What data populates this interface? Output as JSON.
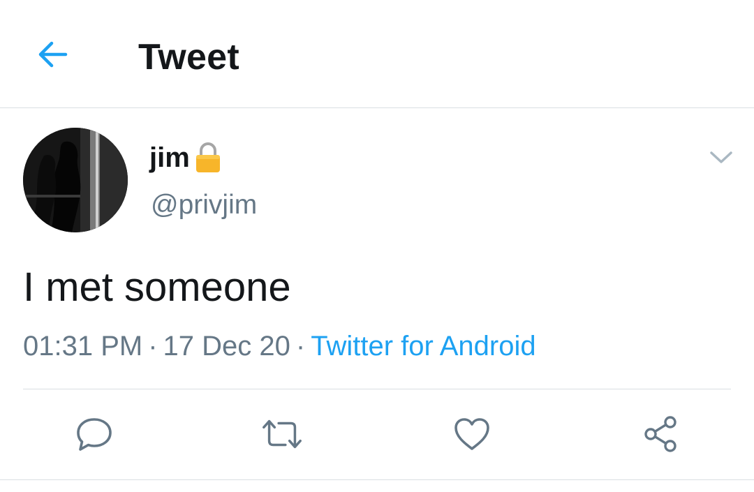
{
  "header": {
    "title": "Tweet",
    "back_icon": "arrow-left-icon"
  },
  "author": {
    "display_name": "jim",
    "protected_icon": "lock-icon",
    "handle": "@privjim"
  },
  "tweet": {
    "text": "I met someone",
    "time": "01:31 PM",
    "separator": "·",
    "date": "17 Dec 20",
    "source": "Twitter for Android"
  },
  "actions": {
    "reply_icon": "reply-icon",
    "retweet_icon": "retweet-icon",
    "like_icon": "heart-icon",
    "share_icon": "share-icon",
    "more_icon": "chevron-down-icon"
  },
  "colors": {
    "accent": "#1da1f2",
    "secondary_text": "#657786",
    "primary_text": "#14171a",
    "divider": "#d9dee2",
    "lock": "#f7b52a"
  }
}
